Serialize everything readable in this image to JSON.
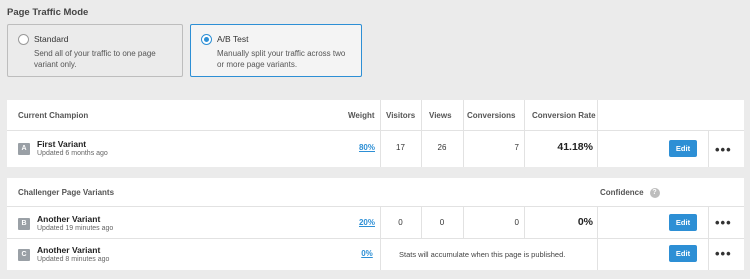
{
  "traffic_mode": {
    "title": "Page Traffic Mode",
    "options": [
      {
        "name": "Standard",
        "description": "Send all of your traffic to one page variant only.",
        "selected": false
      },
      {
        "name": "A/B Test",
        "description": "Manually split your traffic across two or more page variants.",
        "selected": true
      }
    ]
  },
  "champion": {
    "header": {
      "section": "Current Champion",
      "weight": "Weight",
      "visitors": "Visitors",
      "views": "Views",
      "conversions": "Conversions",
      "conversion_rate": "Conversion Rate"
    },
    "rows": [
      {
        "badge": "A",
        "name": "First Variant",
        "updated": "Updated 6 months ago",
        "weight": "80%",
        "visitors": "17",
        "views": "26",
        "conversions": "7",
        "rate": "41.18%",
        "edit": "Edit",
        "more": "•••"
      }
    ]
  },
  "challengers": {
    "header": {
      "section": "Challenger Page Variants",
      "confidence": "Confidence",
      "info_icon": "?"
    },
    "rows": [
      {
        "badge": "B",
        "name": "Another Variant",
        "updated": "Updated 19 minutes ago",
        "weight": "20%",
        "visitors": "0",
        "views": "0",
        "conversions": "0",
        "rate": "0%",
        "edit": "Edit",
        "more": "•••"
      },
      {
        "badge": "C",
        "name": "Another Variant",
        "updated": "Updated 8 minutes ago",
        "weight": "0%",
        "message": "Stats will accumulate when this page is published.",
        "edit": "Edit",
        "more": "•••"
      }
    ]
  },
  "colors": {
    "accent": "#2d8fd5",
    "badge": "#9aa0a6",
    "background": "#ebebeb"
  }
}
